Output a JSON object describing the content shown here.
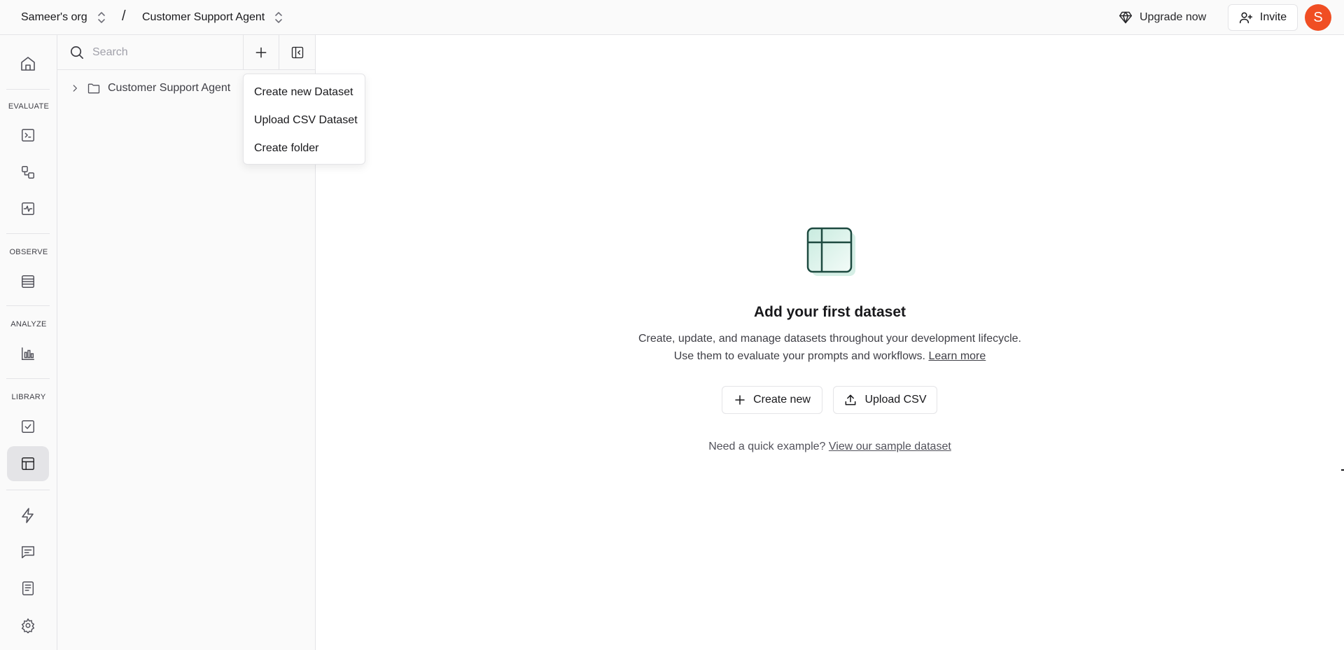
{
  "topbar": {
    "org_name": "Sameer's org",
    "separator": "/",
    "project_name": "Customer Support Agent",
    "upgrade_label": "Upgrade now",
    "invite_label": "Invite",
    "avatar_initial": "S",
    "avatar_color": "#f04e23"
  },
  "rail": {
    "sections": [
      "EVALUATE",
      "OBSERVE",
      "ANALYZE",
      "LIBRARY"
    ],
    "icons": [
      "home-icon",
      "terminal-icon",
      "workflow-icon",
      "activity-icon",
      "table-rows-icon",
      "bar-chart-icon",
      "check-square-icon",
      "datasets-icon",
      "zap-icon",
      "message-icon",
      "book-icon",
      "settings-icon"
    ],
    "active": "datasets-icon"
  },
  "panel": {
    "search_placeholder": "Search",
    "tree": [
      {
        "label": "Customer Support Agent",
        "type": "folder",
        "expanded": false
      }
    ]
  },
  "menu": {
    "items": [
      "Create new Dataset",
      "Upload CSV Dataset",
      "Create folder"
    ]
  },
  "empty_state": {
    "title": "Add your first dataset",
    "desc_line1": "Create, update, and manage datasets throughout your development lifecycle.",
    "desc_line2": "Use them to evaluate your prompts and workflows.",
    "learn_more": "Learn more",
    "create_label": "Create new",
    "upload_label": "Upload CSV",
    "sample_prefix": "Need a quick example?",
    "sample_link": "View our sample dataset",
    "accent_color": "#2f7d68"
  }
}
